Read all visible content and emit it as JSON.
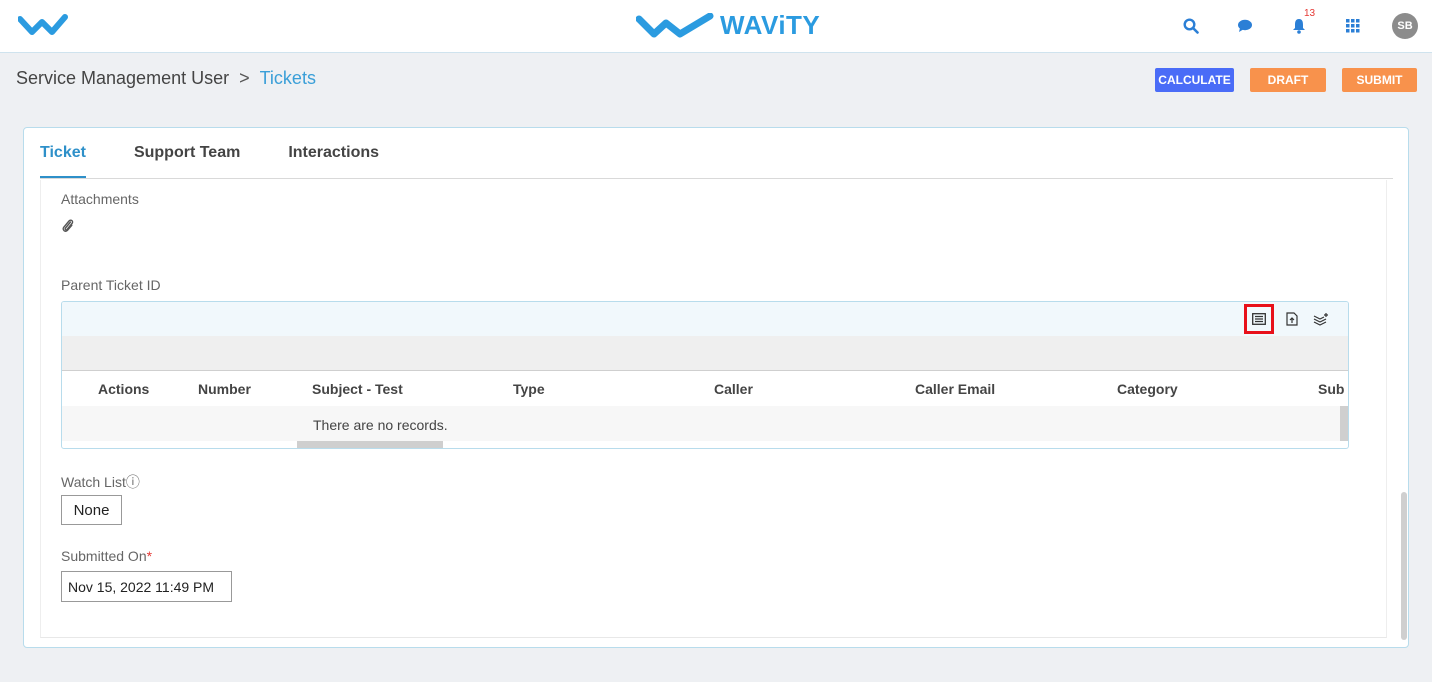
{
  "header": {
    "brand": "WAViTY",
    "notification_count": "13",
    "avatar_initials": "SB"
  },
  "breadcrumb": {
    "parent": "Service Management User",
    "separator": ">",
    "current": "Tickets"
  },
  "actions": {
    "calculate": "CALCULATE",
    "draft": "DRAFT",
    "submit": "SUBMIT"
  },
  "tabs": [
    {
      "label": "Ticket",
      "active": true
    },
    {
      "label": "Support Team",
      "active": false
    },
    {
      "label": "Interactions",
      "active": false
    }
  ],
  "form": {
    "attachments_label": "Attachments",
    "parent_ticket_label": "Parent Ticket ID",
    "watch_list_label": "Watch Listⓘ",
    "watch_list_value": "None",
    "submitted_on_label": "Submitted On",
    "submitted_on_required": "*",
    "submitted_on_value": "Nov 15, 2022 11:49 PM"
  },
  "grid": {
    "columns": [
      "Actions",
      "Number",
      "Subject - Test",
      "Type",
      "Caller",
      "Caller Email",
      "Category",
      "Sub C"
    ],
    "empty_message": "There are no records.",
    "toolbar_icons": [
      "list-view-icon",
      "export-file-icon",
      "layers-add-icon"
    ]
  },
  "colors": {
    "accent": "#2e90c9",
    "calculate": "#4a6cf7",
    "orange": "#f8924c",
    "highlight": "#e8101a"
  }
}
